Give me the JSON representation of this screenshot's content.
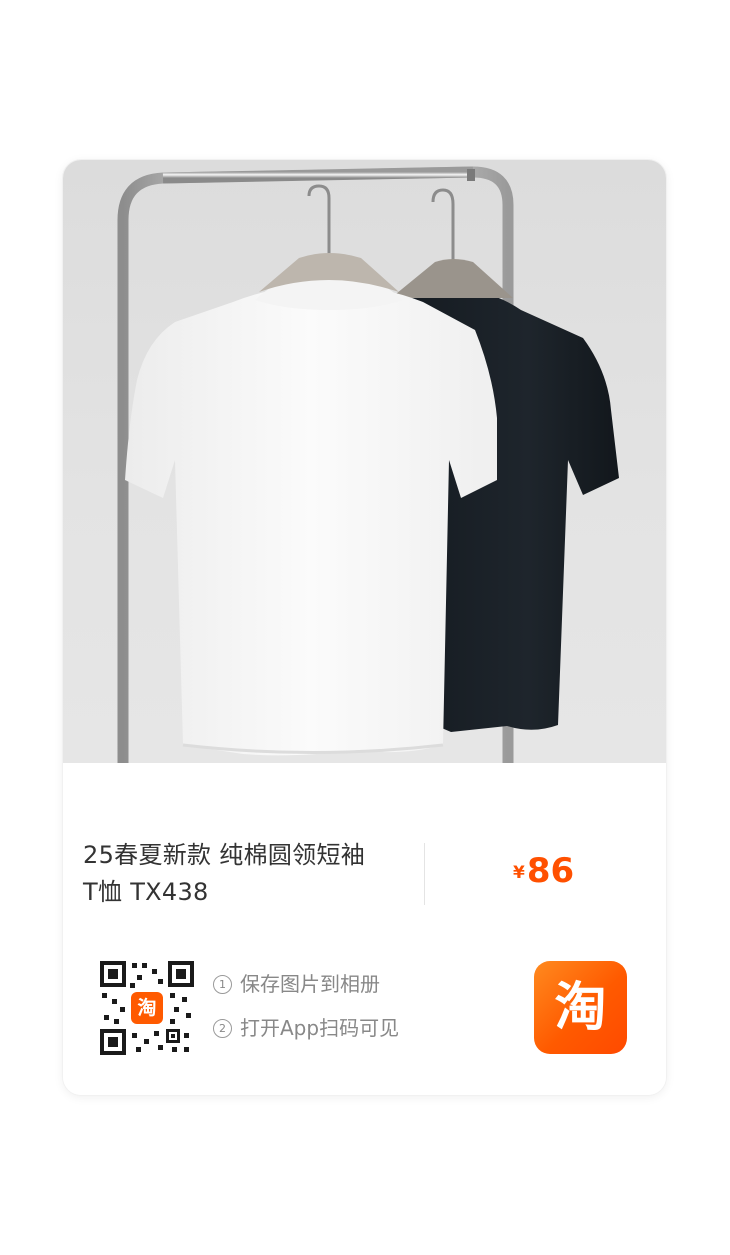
{
  "product": {
    "title_line1": "25春夏新款 纯棉圆领短袖",
    "title_line2": "T恤 TX438",
    "price_symbol": "¥",
    "price_value": "86",
    "image_desc_icon": "tshirts-on-rack-photo"
  },
  "qr": {
    "badge_char": "淘",
    "icon": "qr-code-icon"
  },
  "steps": [
    {
      "num": "1",
      "text": "保存图片到相册"
    },
    {
      "num": "2",
      "text": "打开App扫码可见"
    }
  ],
  "app_logo": {
    "char": "淘",
    "color": "#ff5000"
  },
  "colors": {
    "accent": "#ff5000"
  }
}
